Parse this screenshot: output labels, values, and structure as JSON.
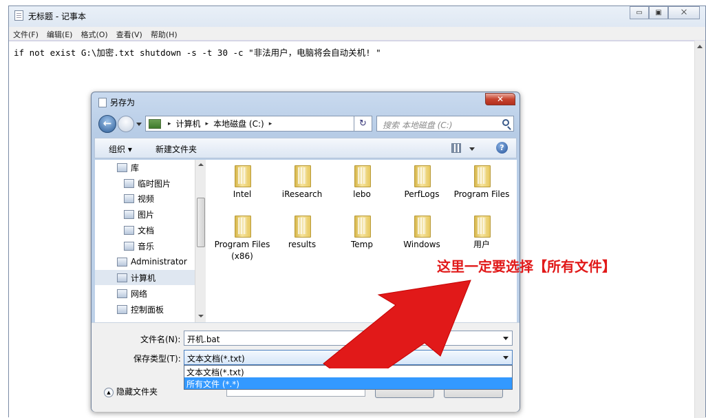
{
  "notepad": {
    "title": "无标题 - 记事本",
    "window_buttons": [
      "▭",
      "▣",
      "⨉"
    ],
    "menu": [
      "文件(F)",
      "编辑(E)",
      "格式(O)",
      "查看(V)",
      "帮助(H)"
    ],
    "content": "if not exist G:\\加密.txt shutdown -s -t 30 -c \"非法用户，电脑将会自动关机! \""
  },
  "dialog": {
    "title": "另存为",
    "close": "✕",
    "nav": {
      "back": "←"
    },
    "address": {
      "parts": [
        "计算机",
        "本地磁盘 (C:)"
      ],
      "sep": "▸",
      "refresh": "↻"
    },
    "search_placeholder": "搜索 本地磁盘 (C:)",
    "toolbar": {
      "organize": "组织 ▾",
      "new_folder": "新建文件夹",
      "help": "?"
    },
    "tree": [
      {
        "label": "库",
        "indent": 0
      },
      {
        "label": "临时图片",
        "indent": 1
      },
      {
        "label": "视频",
        "indent": 1
      },
      {
        "label": "图片",
        "indent": 1
      },
      {
        "label": "文档",
        "indent": 1
      },
      {
        "label": "音乐",
        "indent": 1
      },
      {
        "label": "Administrator",
        "indent": 0
      },
      {
        "label": "计算机",
        "indent": 0,
        "selected": true
      },
      {
        "label": "网络",
        "indent": 0
      },
      {
        "label": "控制面板",
        "indent": 0
      }
    ],
    "files": [
      "Intel",
      "iResearch",
      "lebo",
      "PerfLogs",
      "Program Files",
      "Program Files (x86)",
      "results",
      "Temp",
      "Windows",
      "用户"
    ],
    "filename_label": "文件名(N):",
    "filename_value": "开机.bat",
    "filetype_label": "保存类型(T):",
    "filetype_value": "文本文档(*.txt)",
    "filetype_options": [
      "文本文档(*.txt)",
      "所有文件  (*.*)"
    ],
    "filetype_selected_index": 1,
    "hide_folders": "隐藏文件夹",
    "hide_folders_icon": "▲"
  },
  "annotation": {
    "text": "这里一定要选择【所有文件】",
    "color": "#e11919"
  }
}
